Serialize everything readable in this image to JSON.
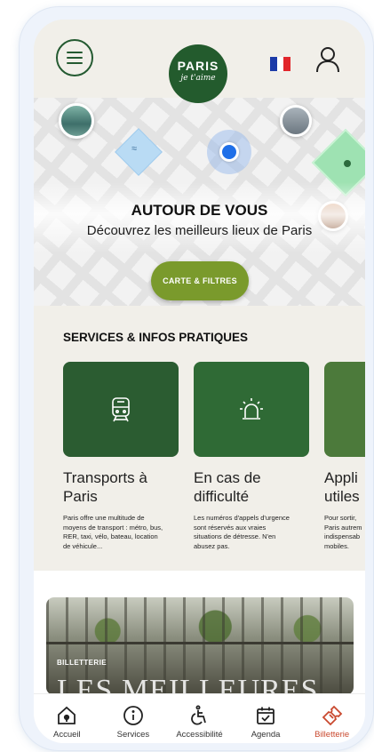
{
  "header": {
    "logo_line1": "PARIS",
    "logo_line2": "je t'aime",
    "flag_colors": [
      "#1c3ba8",
      "#ffffff",
      "#e1262b"
    ],
    "icons": [
      "menu-icon",
      "france-flag-icon",
      "user-icon"
    ]
  },
  "map": {
    "title": "AUTOUR DE VOUS",
    "subtitle": "Découvrez les meilleurs lieux de Paris",
    "button_label": "CARTE & FILTRES"
  },
  "services": {
    "title": "SERVICES & INFOS PRATIQUES",
    "cards": [
      {
        "icon": "train-icon",
        "title": "Transports à\nParis",
        "desc": "Paris offre une multitude de\nmoyens de transport : métro, bus,\nRER, taxi, vélo, bateau, location\nde véhicule...",
        "color": "#2b5c31"
      },
      {
        "icon": "alarm-light-icon",
        "title": "En cas de\ndifficulté",
        "desc": "Les numéros d'appels d'urgence\nsont réservés aux vraies\nsituations de détresse. N'en\nabusez pas.",
        "color": "#2f6a35"
      },
      {
        "icon": "app-icon",
        "title": "Appli\nutiles",
        "desc": "Pour sortir,\nParis autrem\nindispensab\nmobiles.",
        "color": "#4c7a3b"
      }
    ]
  },
  "billetterie": {
    "tag": "BILLETTERIE",
    "headline": "LES MEILLEURES"
  },
  "tabbar": {
    "active_color": "#c9492f",
    "items": [
      {
        "label": "Accueil",
        "icon": "home-icon"
      },
      {
        "label": "Services",
        "icon": "info-icon"
      },
      {
        "label": "Accessibilité",
        "icon": "wheelchair-icon"
      },
      {
        "label": "Agenda",
        "icon": "calendar-icon"
      },
      {
        "label": "Billetterie",
        "icon": "ticket-icon"
      }
    ]
  }
}
